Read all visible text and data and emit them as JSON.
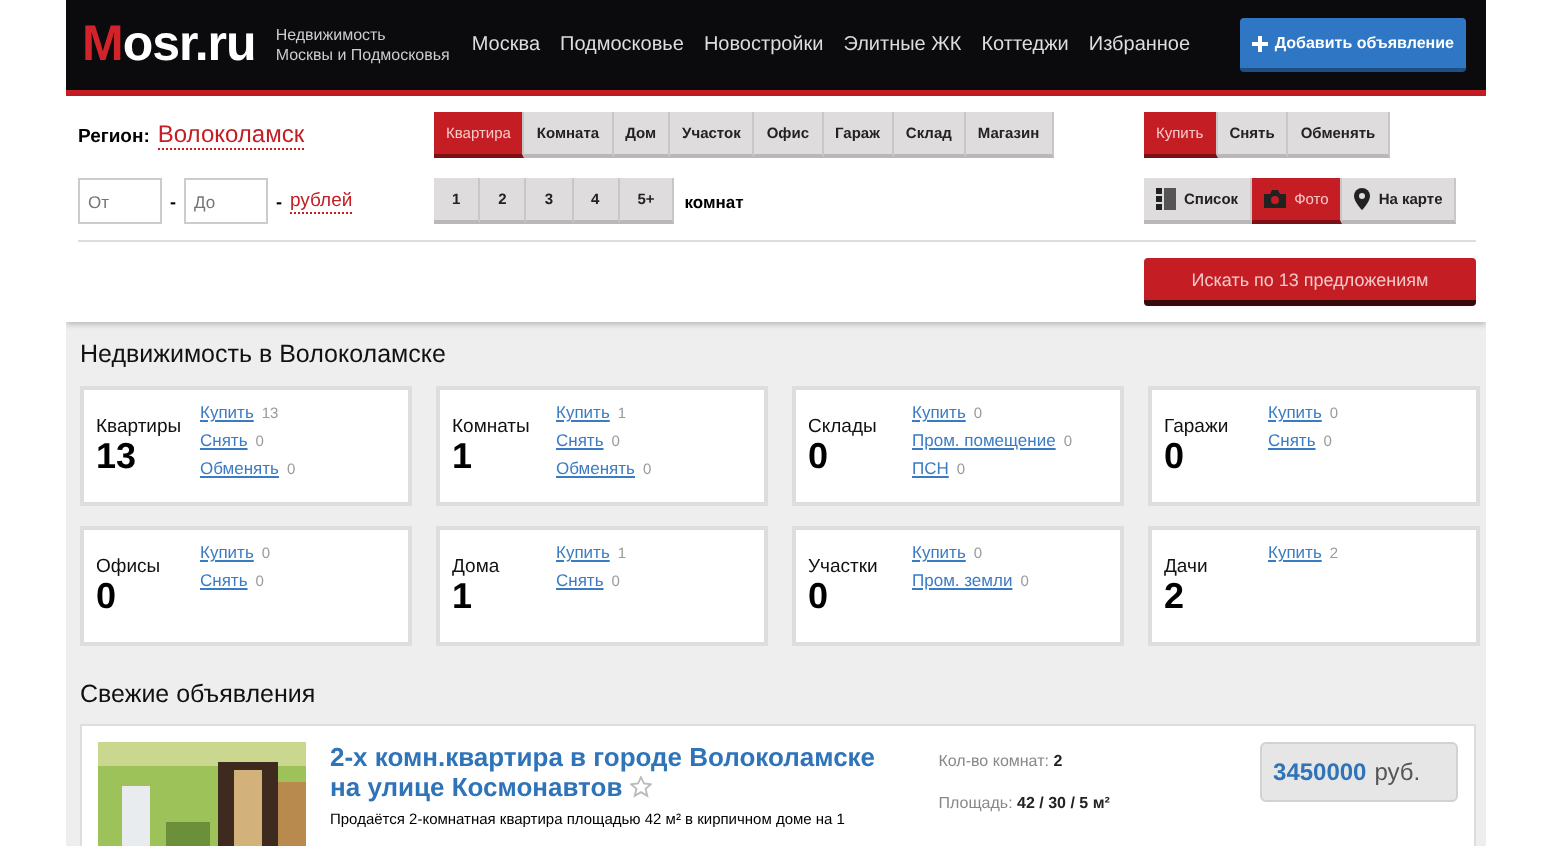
{
  "header": {
    "logo": "Mosr.ru",
    "tagline": [
      "Недвижимость",
      "Москвы и Подмосковья"
    ],
    "nav": [
      "Москва",
      "Подмосковье",
      "Новостройки",
      "Элитные ЖК",
      "Коттеджи",
      "Избранное"
    ],
    "add_button": {
      "label": "Добавить объявление"
    }
  },
  "filter": {
    "region_label": "Регион:",
    "region": "Волоколамск",
    "price_from": {
      "placeholder": "От"
    },
    "separator": "-",
    "price_to": {
      "placeholder": "До"
    },
    "currency_separator": "-",
    "currency": "рублей",
    "property_types": [
      {
        "label": "Квартира",
        "selected": true
      },
      {
        "label": "Комната",
        "selected": false
      },
      {
        "label": "Дом",
        "selected": false
      },
      {
        "label": "Участок",
        "selected": false
      },
      {
        "label": "Офис",
        "selected": false
      },
      {
        "label": "Гараж",
        "selected": false
      },
      {
        "label": "Склад",
        "selected": false
      },
      {
        "label": "Магазин",
        "selected": false
      }
    ],
    "rooms": [
      {
        "label": "1",
        "selected": false
      },
      {
        "label": "2",
        "selected": false
      },
      {
        "label": "3",
        "selected": false
      },
      {
        "label": "4",
        "selected": false
      },
      {
        "label": "5+",
        "selected": false
      }
    ],
    "rooms_label": "комнат",
    "deals": [
      {
        "label": "Купить",
        "selected": true
      },
      {
        "label": "Снять",
        "selected": false
      },
      {
        "label": "Обменять",
        "selected": false
      }
    ],
    "views": [
      {
        "kind": "list",
        "label": "Список",
        "selected": false
      },
      {
        "label": "Фото",
        "selected": true
      },
      {
        "kind": "map",
        "label": "На карте",
        "selected": false
      }
    ],
    "search_button": "Искать по 13 предложениям"
  },
  "categories_title": "Недвижимость в Волоколамске",
  "categories": [
    {
      "title": "Квартиры",
      "count": "13",
      "links": [
        {
          "label": "Купить",
          "count": "13"
        },
        {
          "label": "Снять",
          "count": "0"
        },
        {
          "label": "Обменять",
          "count": "0"
        }
      ]
    },
    {
      "title": "Комнаты",
      "count": "1",
      "links": [
        {
          "label": "Купить",
          "count": "1"
        },
        {
          "label": "Снять",
          "count": "0"
        },
        {
          "label": "Обменять",
          "count": "0"
        }
      ]
    },
    {
      "title": "Склады",
      "count": "0",
      "links": [
        {
          "label": "Купить",
          "count": "0"
        },
        {
          "label": "Пром. помещение",
          "count": "0"
        },
        {
          "label": "ПСН",
          "count": "0"
        }
      ]
    },
    {
      "title": "Гаражи",
      "count": "0",
      "links": [
        {
          "label": "Купить",
          "count": "0"
        },
        {
          "label": "Снять",
          "count": "0"
        }
      ]
    },
    {
      "title": "Офисы",
      "count": "0",
      "links": [
        {
          "label": "Купить",
          "count": "0"
        },
        {
          "label": "Снять",
          "count": "0"
        }
      ]
    },
    {
      "title": "Дома",
      "count": "1",
      "links": [
        {
          "label": "Купить",
          "count": "1"
        },
        {
          "label": "Снять",
          "count": "0"
        }
      ]
    },
    {
      "title": "Участки",
      "count": "0",
      "links": [
        {
          "label": "Купить",
          "count": "0"
        },
        {
          "label": "Пром. земли",
          "count": "0"
        }
      ]
    },
    {
      "title": "Дачи",
      "count": "2",
      "links": [
        {
          "label": "Купить",
          "count": "2"
        }
      ]
    }
  ],
  "listings_title": "Свежие объявления",
  "listings": [
    {
      "photo": {
        "kind": "picture"
      },
      "title": "2-х комн.квартира в городе Волоколамске на улице Космонавтов",
      "favorite": false,
      "description": "Продаётся 2-комнатная квартира площадью 42 м² в кирпичном доме на 1",
      "specs": [
        {
          "label": "Кол-во комнат:",
          "value": "2"
        },
        {
          "label": "Площадь:",
          "value": "42 / 30 / 5 м²"
        }
      ],
      "price": "3450000",
      "currency": "руб."
    }
  ]
}
